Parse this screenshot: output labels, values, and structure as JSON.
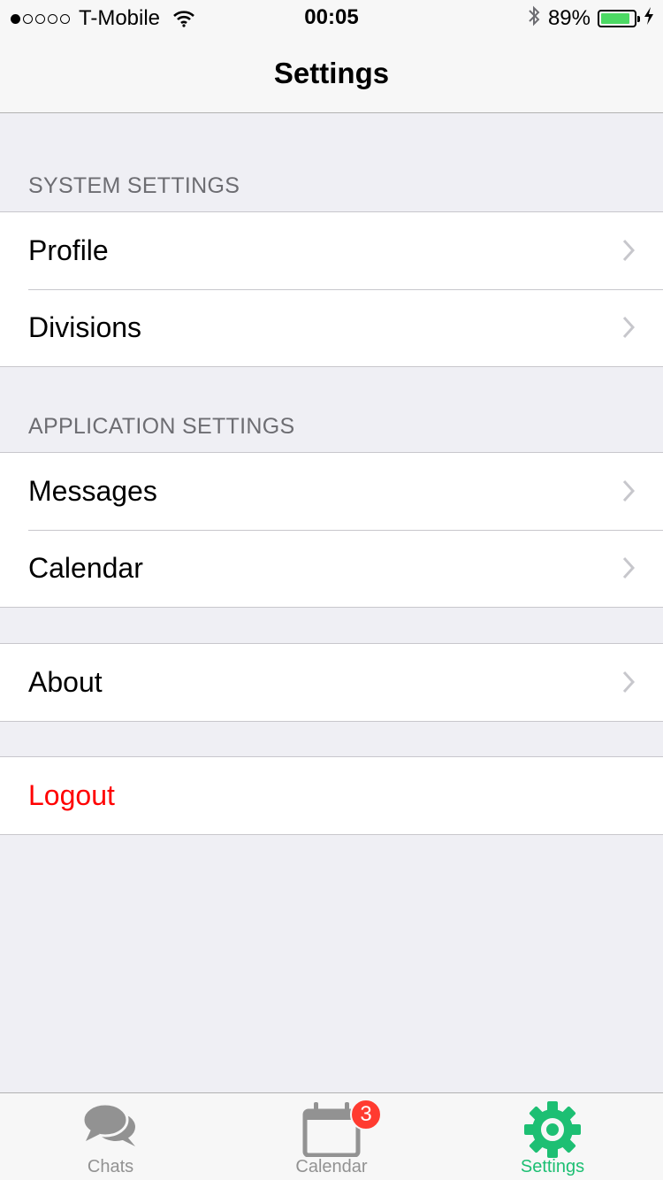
{
  "status_bar": {
    "carrier": "T-Mobile",
    "signal_bars_filled": 1,
    "signal_bars_total": 5,
    "time": "00:05",
    "battery_percent": "89%",
    "battery_level": 0.89,
    "battery_color": "#4cd964"
  },
  "nav": {
    "title": "Settings"
  },
  "sections": {
    "system": {
      "header": "SYSTEM SETTINGS",
      "items": [
        {
          "label": "Profile"
        },
        {
          "label": "Divisions"
        }
      ]
    },
    "application": {
      "header": "APPLICATION SETTINGS",
      "items": [
        {
          "label": "Messages"
        },
        {
          "label": "Calendar"
        }
      ]
    },
    "about": {
      "items": [
        {
          "label": "About"
        }
      ]
    },
    "logout": {
      "label": "Logout",
      "color": "#ff0000"
    }
  },
  "tabbar": {
    "tabs": [
      {
        "label": "Chats",
        "icon": "chat-bubbles-icon",
        "active": false
      },
      {
        "label": "Calendar",
        "icon": "calendar-icon",
        "active": false,
        "badge": "3"
      },
      {
        "label": "Settings",
        "icon": "gear-icon",
        "active": true
      }
    ],
    "active_color": "#1dbf73",
    "inactive_color": "#929292",
    "badge_color": "#ff3b30"
  }
}
